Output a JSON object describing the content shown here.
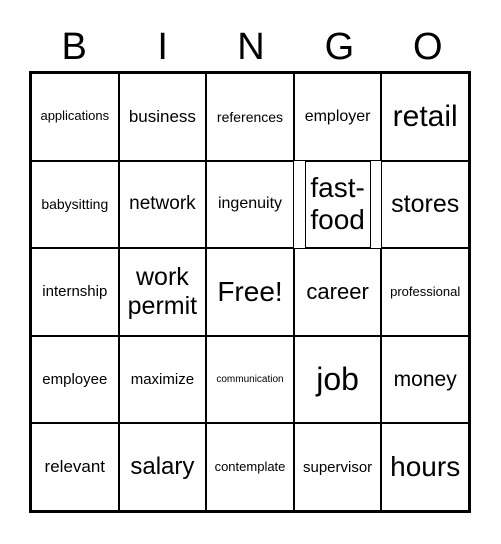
{
  "header": [
    "B",
    "I",
    "N",
    "G",
    "O"
  ],
  "cells": [
    "applications",
    "business",
    "references",
    "employer",
    "retail",
    "babysitting",
    "network",
    "ingenuity",
    "fast-food",
    "stores",
    "internship",
    "work permit",
    "Free!",
    "career",
    "professional",
    "employee",
    "maximize",
    "communication",
    "job",
    "money",
    "relevant",
    "salary",
    "contemplate",
    "supervisor",
    "hours"
  ]
}
